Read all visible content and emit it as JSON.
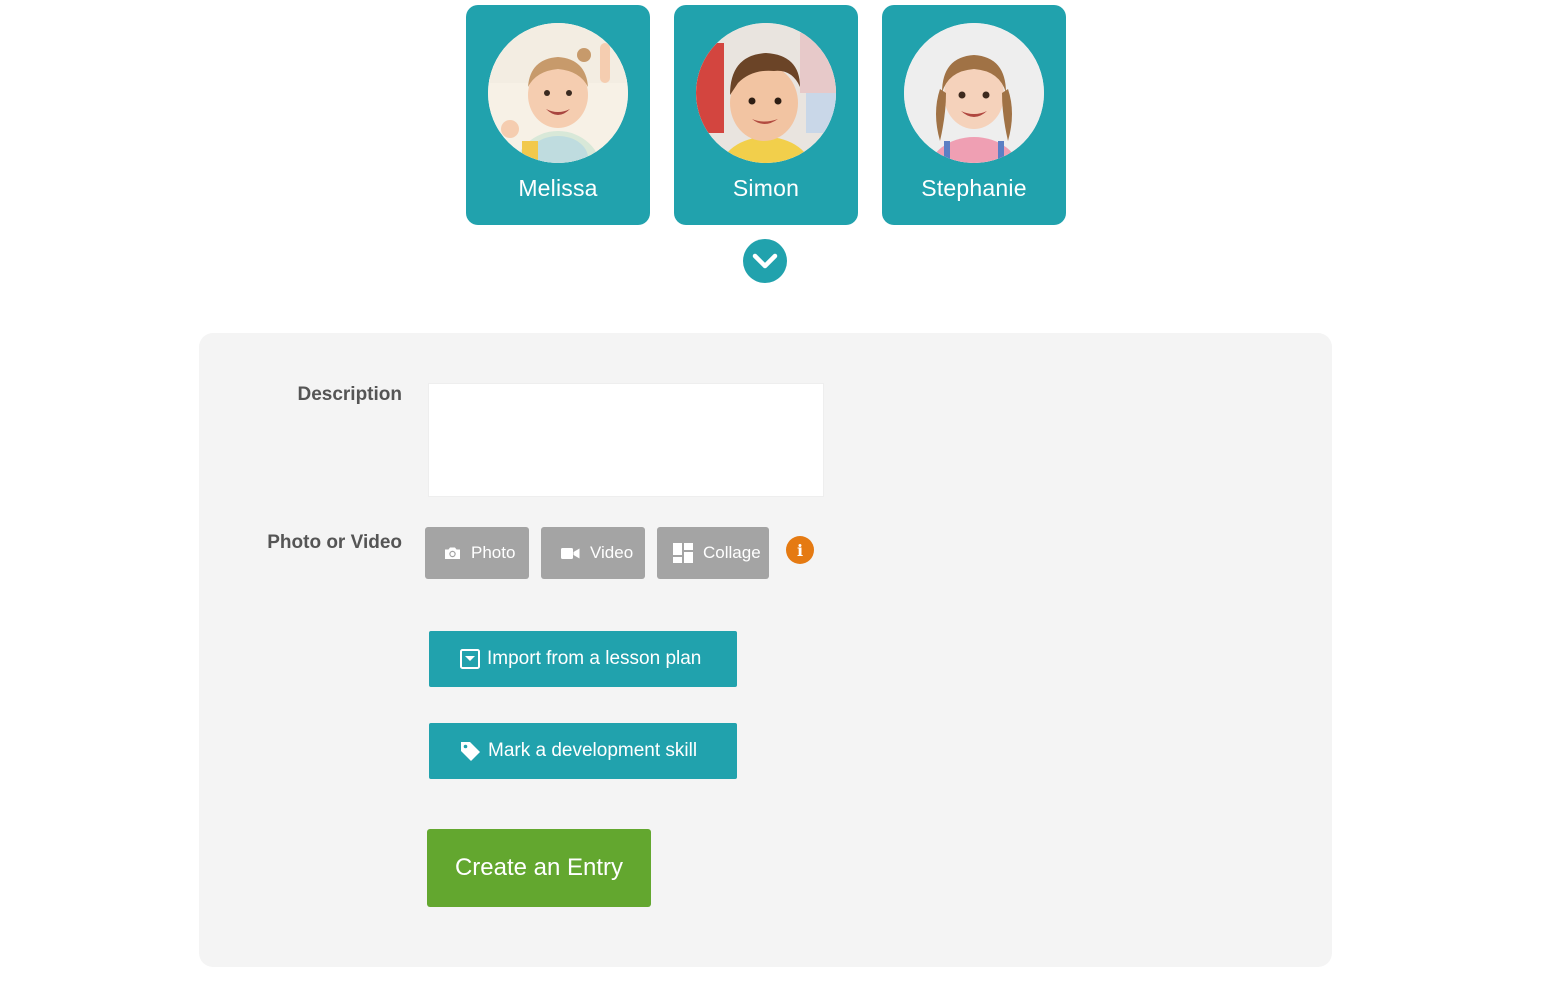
{
  "colors": {
    "teal": "#21a2ad",
    "gray_button": "#a4a4a4",
    "orange_info": "#e57a12",
    "green_create": "#63a72f",
    "panel_bg": "#f4f4f4",
    "label_text": "#555555"
  },
  "children": [
    {
      "name": "Melissa",
      "avatar_icon": "child-photo-girl-1"
    },
    {
      "name": "Simon",
      "avatar_icon": "child-photo-boy"
    },
    {
      "name": "Stephanie",
      "avatar_icon": "child-photo-girl-2"
    }
  ],
  "expand_toggle": {
    "icon": "chevron-down-icon"
  },
  "form": {
    "description_label": "Description",
    "description_value": "",
    "media_label": "Photo or Video",
    "media_buttons": [
      {
        "label": "Photo",
        "icon": "camera-icon"
      },
      {
        "label": "Video",
        "icon": "video-camera-icon"
      },
      {
        "label": "Collage",
        "icon": "collage-icon"
      }
    ],
    "info_icon": "i",
    "import_button": {
      "label": "Import from a lesson plan",
      "icon": "import-icon"
    },
    "skill_button": {
      "label": "Mark a development skill",
      "icon": "tag-icon"
    },
    "create_button": {
      "label": "Create an Entry"
    }
  }
}
